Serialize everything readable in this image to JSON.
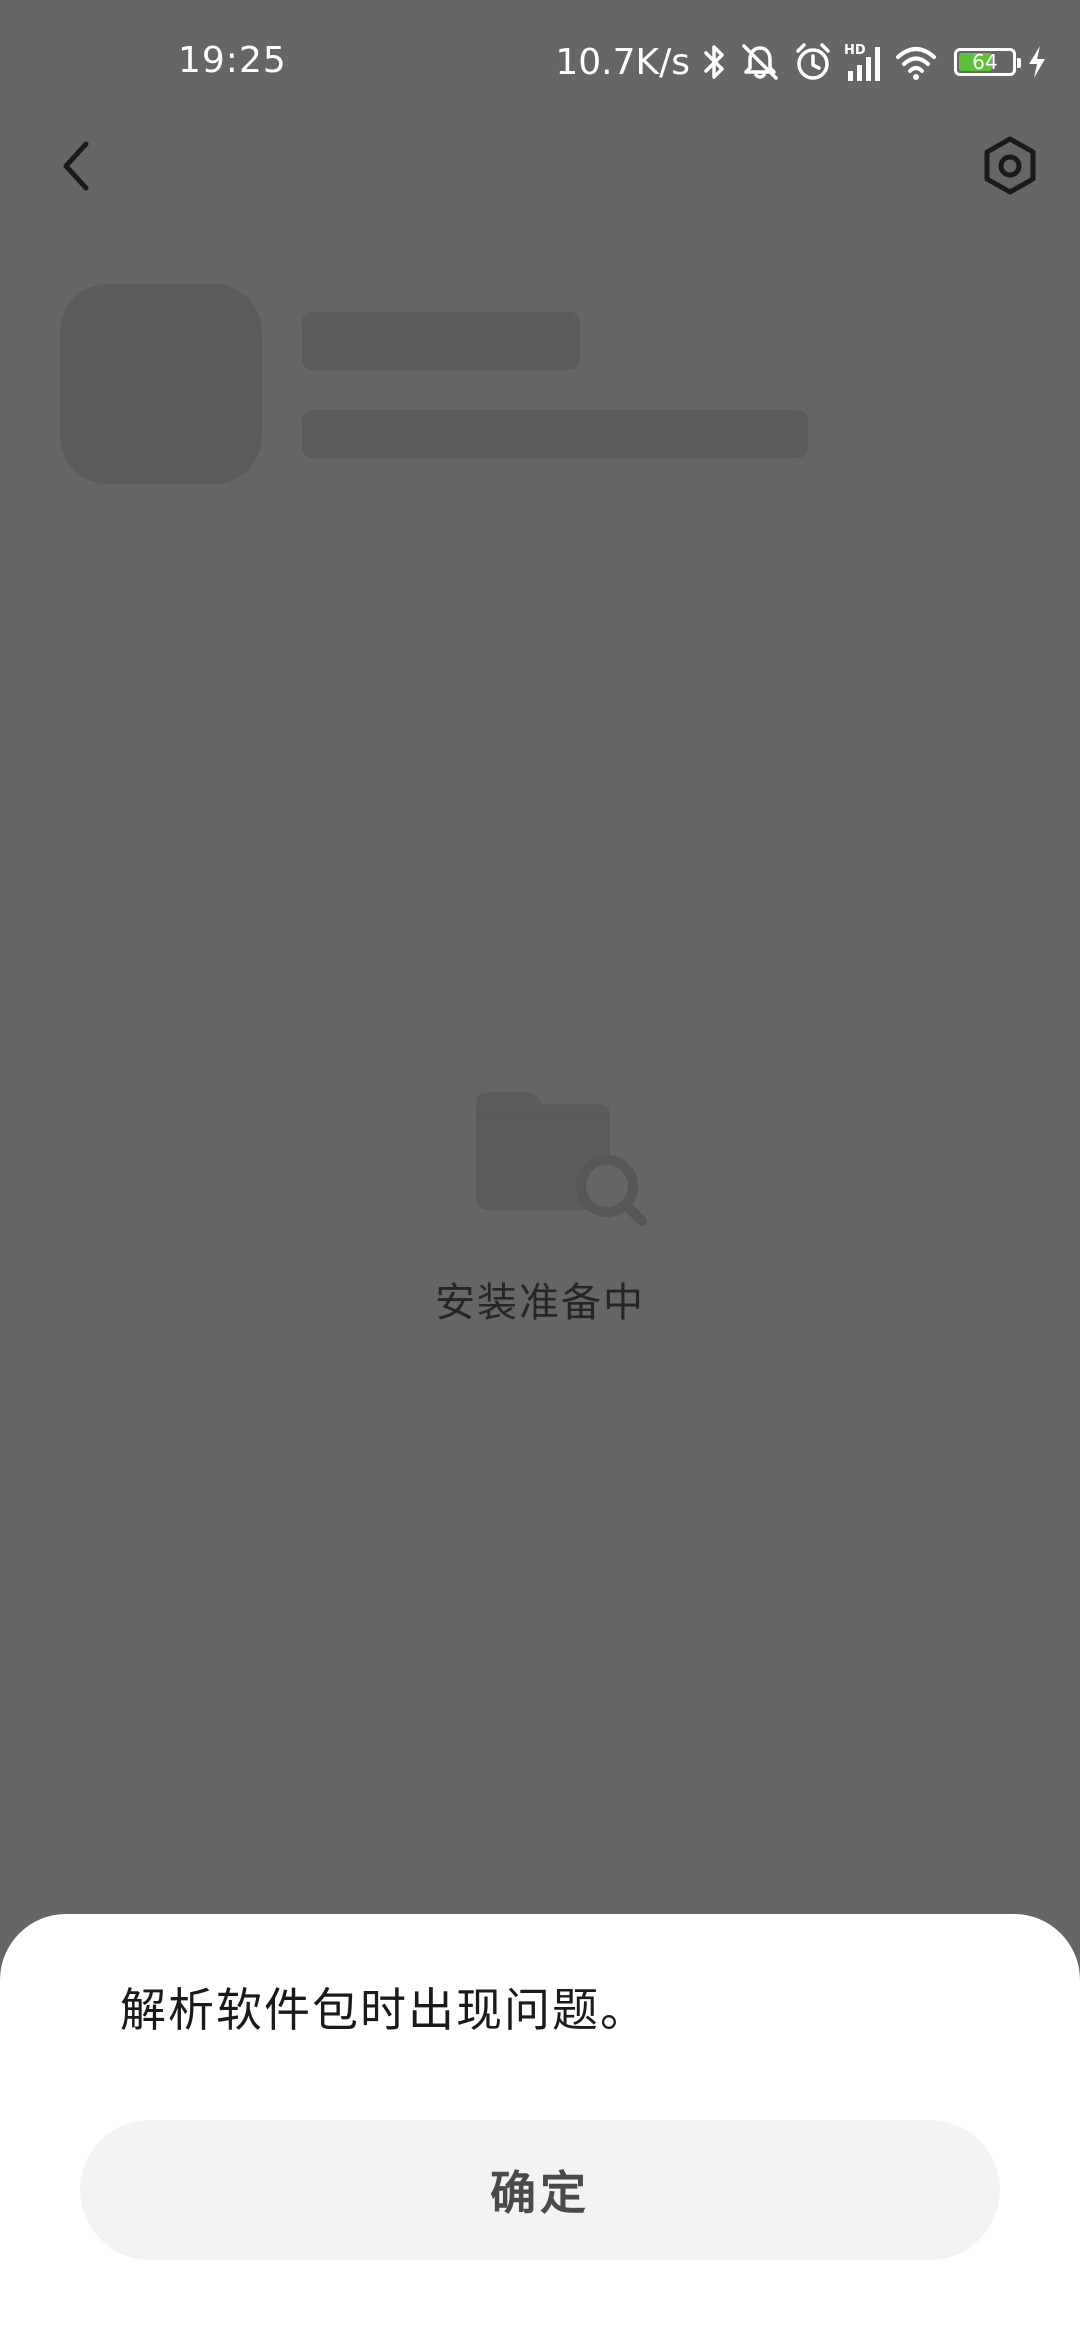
{
  "status_bar": {
    "time": "19:25",
    "net_speed": "10.7K/s",
    "battery_level": "64",
    "battery_fraction": 0.64,
    "icons": [
      "bluetooth-icon",
      "bell-muted-icon",
      "alarm-icon",
      "hd-signal-icon",
      "wifi-icon",
      "battery-icon",
      "charging-icon"
    ]
  },
  "nav": {
    "back_icon": "back-arrow-icon",
    "settings_icon": "settings-gear-icon"
  },
  "loading": {
    "icon": "folder-search-icon",
    "text": "安装准备中"
  },
  "dialog": {
    "message": "解析软件包时出现问题。",
    "confirm_label": "确定"
  },
  "colors": {
    "overlay_background": "#666666",
    "skeleton": "#5c5c5c",
    "dialog_background": "#ffffff",
    "button_background": "#f3f3f3",
    "battery_fill": "#5fc13a"
  }
}
